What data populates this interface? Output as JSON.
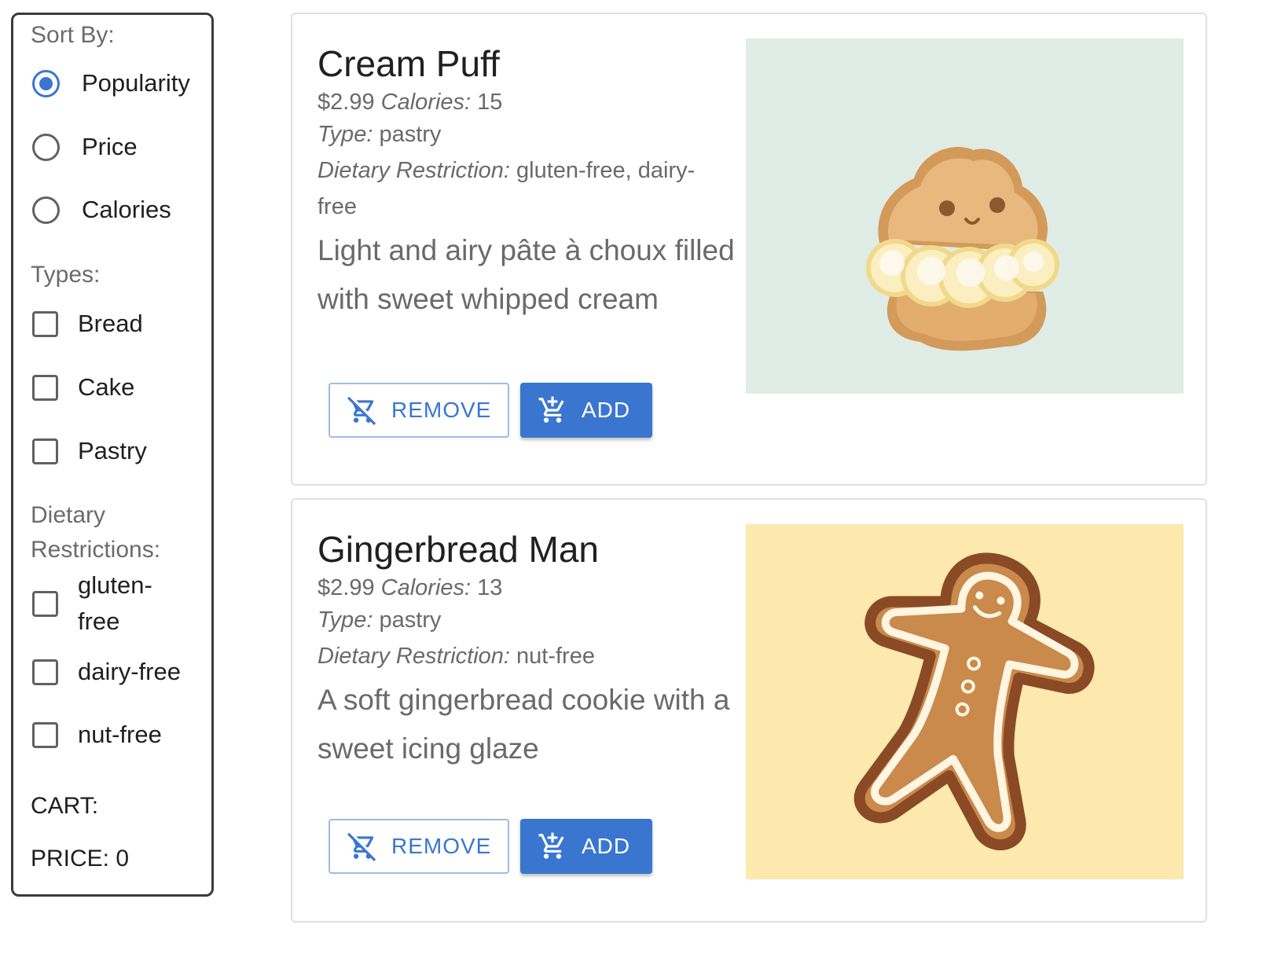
{
  "sidebar": {
    "sort_title": "Sort By:",
    "sort_options": [
      {
        "label": "Popularity",
        "selected": true
      },
      {
        "label": "Price",
        "selected": false
      },
      {
        "label": "Calories",
        "selected": false
      }
    ],
    "types_title": "Types:",
    "types": [
      {
        "label": "Bread",
        "checked": false
      },
      {
        "label": "Cake",
        "checked": false
      },
      {
        "label": "Pastry",
        "checked": false
      }
    ],
    "diet_title": "Dietary Restrictions:",
    "diets": [
      {
        "label": "gluten-free",
        "checked": false
      },
      {
        "label": "dairy-free",
        "checked": false
      },
      {
        "label": "nut-free",
        "checked": false
      }
    ],
    "cart_label": "CART:",
    "price_label": "PRICE: 0"
  },
  "items": [
    {
      "name": "Cream Puff",
      "price": "$2.99",
      "calories_label": "Calories:",
      "calories": "15",
      "type_label": "Type:",
      "type": "pastry",
      "diet_label": "Dietary Restriction:",
      "diet": "gluten-free, dairy-free",
      "description": "Light and airy pâte à choux filled with sweet whipped cream",
      "remove_label": "REMOVE",
      "add_label": "ADD",
      "image_bg": "#e0ece6"
    },
    {
      "name": "Gingerbread Man",
      "price": "$2.99",
      "calories_label": "Calories:",
      "calories": "13",
      "type_label": "Type:",
      "type": "pastry",
      "diet_label": "Dietary Restriction:",
      "diet": "nut-free",
      "description": "A soft gingerbread cookie with a sweet icing glaze",
      "remove_label": "REMOVE",
      "add_label": "ADD",
      "image_bg": "#fde9ad"
    }
  ],
  "colors": {
    "accent": "#3a76d0",
    "sidebar_border": "#3b3b3b",
    "muted_text": "#6a6a6a"
  }
}
